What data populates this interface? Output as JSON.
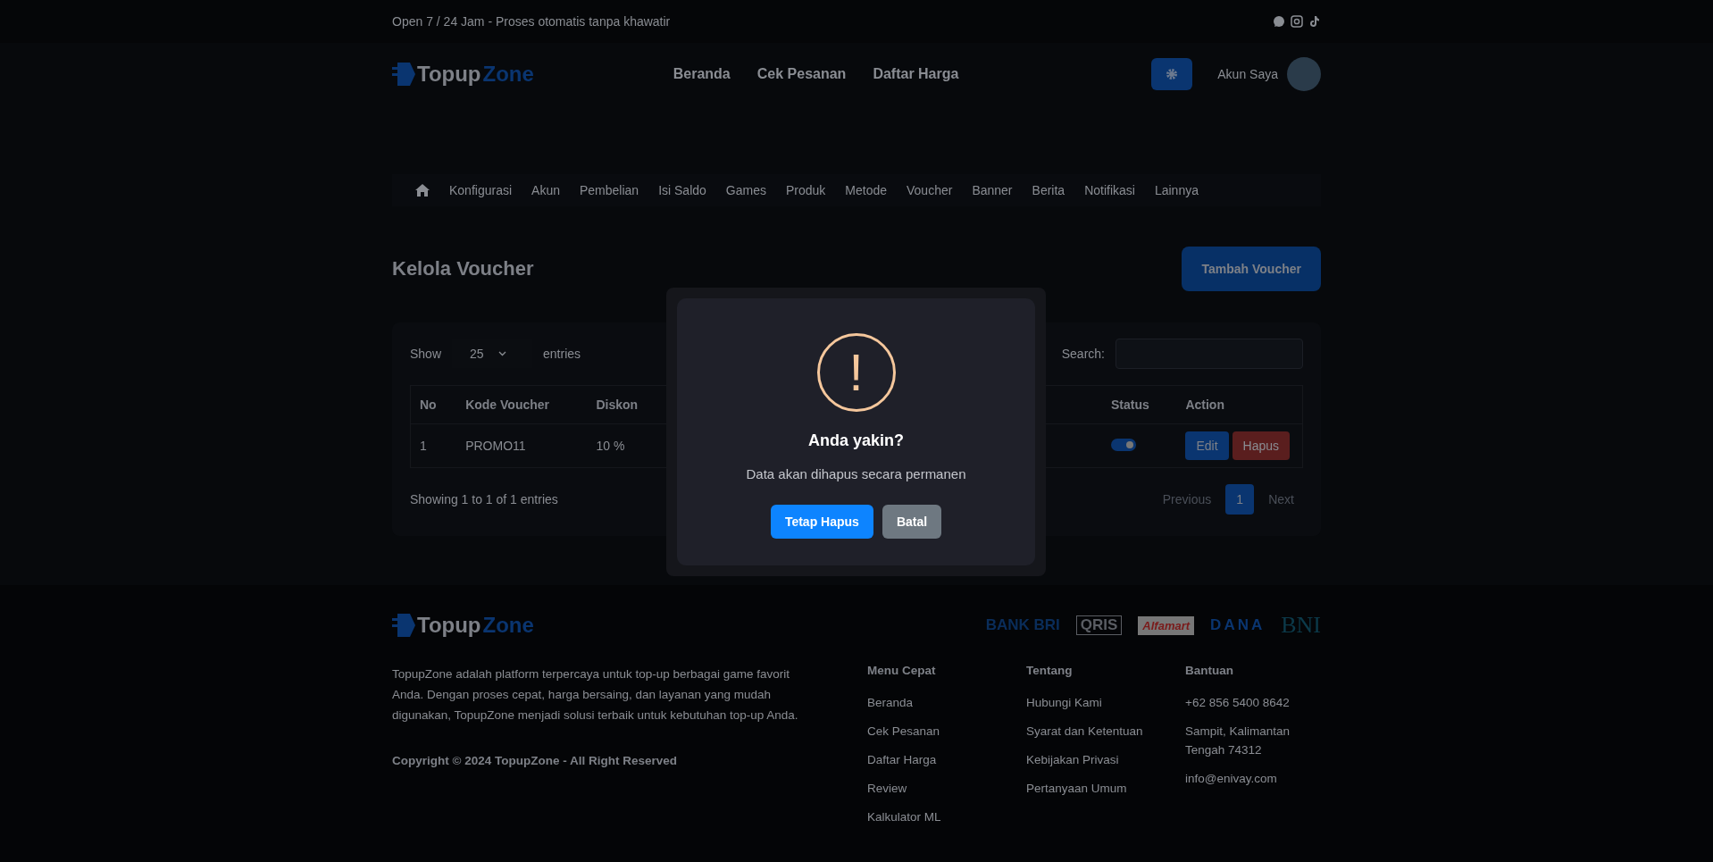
{
  "top_bar": {
    "text": "Open 7 / 24 Jam - Proses otomatis tanpa khawatir"
  },
  "header": {
    "logo": [
      "Topup",
      "Zone"
    ],
    "nav": [
      "Beranda",
      "Cek Pesanan",
      "Daftar Harga"
    ],
    "account": "Akun Saya"
  },
  "admin_menu": [
    "Konfigurasi",
    "Akun",
    "Pembelian",
    "Isi Saldo",
    "Games",
    "Produk",
    "Metode",
    "Voucher",
    "Banner",
    "Berita",
    "Notifikasi",
    "Lainnya"
  ],
  "page": {
    "title": "Kelola Voucher",
    "add_button": "Tambah Voucher"
  },
  "table_controls": {
    "show": "Show",
    "page_size": "25",
    "entries": "entries",
    "search_label": "Search:"
  },
  "table": {
    "columns": [
      "No",
      "Kode Voucher",
      "Diskon",
      "Status",
      "Action"
    ],
    "rows": [
      {
        "no": "1",
        "code": "PROMO11",
        "discount": "10 %",
        "status_on": true,
        "actions": [
          "Edit",
          "Hapus"
        ]
      }
    ]
  },
  "table_footer": {
    "info": "Showing 1 to 1 of 1 entries",
    "pages": [
      {
        "label": "Previous",
        "selected": false
      },
      {
        "label": "1",
        "selected": true
      },
      {
        "label": "Next",
        "selected": false
      }
    ]
  },
  "dialog": {
    "icon": "!",
    "title": "Anda yakin?",
    "message": "Data akan dihapus secara permanen",
    "confirm": "Tetap Hapus",
    "cancel": "Batal"
  },
  "footer": {
    "logo": [
      "Topup",
      "Zone"
    ],
    "payment_logos": [
      "BANK BRI",
      "QRIS",
      "Alfamart",
      "DANA",
      "BNI"
    ],
    "description": "TopupZone adalah platform terpercaya untuk top-up berbagai game favorit Anda. Dengan proses cepat, harga bersaing, dan layanan yang mudah digunakan, TopupZone menjadi solusi terbaik untuk kebutuhan top-up Anda.",
    "copyright": "Copyright © 2024 TopupZone - All Right Reserved",
    "columns": [
      {
        "heading": "Menu Cepat",
        "items": [
          "Beranda",
          "Cek Pesanan",
          "Daftar Harga",
          "Review",
          "Kalkulator ML"
        ]
      },
      {
        "heading": "Tentang",
        "items": [
          "Hubungi Kami",
          "Syarat dan Ketentuan",
          "Kebijakan Privasi",
          "Pertanyaan Umum"
        ]
      },
      {
        "heading": "Bantuan",
        "items": [
          "+62 856 5400 8642",
          "Sampit, Kalimantan Tengah 74312",
          "info@enivay.com"
        ]
      }
    ]
  }
}
